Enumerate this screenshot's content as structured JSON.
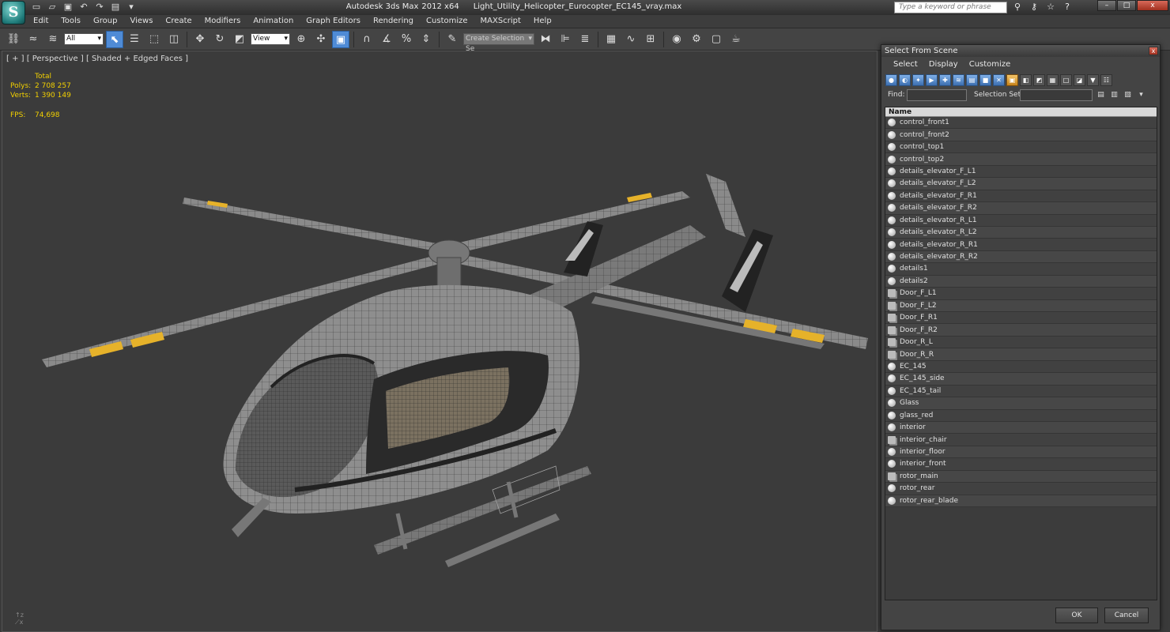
{
  "titlebar": {
    "app_name": "Autodesk 3ds Max",
    "version": "2012 x64",
    "filename": "Light_Utility_Helicopter_Eurocopter_EC145_vray.max",
    "search_placeholder": "Type a keyword or phrase",
    "logo_glyph": "S",
    "close_glyph": "x"
  },
  "menu": [
    "Edit",
    "Tools",
    "Group",
    "Views",
    "Create",
    "Modifiers",
    "Animation",
    "Graph Editors",
    "Rendering",
    "Customize",
    "MAXScript",
    "Help"
  ],
  "toolbar": {
    "filter_value": "All",
    "ref_coord_value": "View",
    "selection_set_value": "Create Selection Se"
  },
  "viewport": {
    "label": "[ + ] [ Perspective ] [ Shaded + Edged Faces ]",
    "stats": {
      "total_label": "Total",
      "polys_label": "Polys:",
      "polys_value": "2 708 257",
      "verts_label": "Verts:",
      "verts_value": "1 390 149",
      "fps_label": "FPS:",
      "fps_value": "74,698"
    }
  },
  "dialog": {
    "title": "Select From Scene",
    "menu": [
      "Select",
      "Display",
      "Customize"
    ],
    "find_label": "Find:",
    "selection_set_label": "Selection Set:",
    "column_name": "Name",
    "ok_label": "OK",
    "cancel_label": "Cancel",
    "items": [
      {
        "name": "control_front1",
        "kind": "object"
      },
      {
        "name": "control_front2",
        "kind": "object"
      },
      {
        "name": "control_top1",
        "kind": "object"
      },
      {
        "name": "control_top2",
        "kind": "object"
      },
      {
        "name": "details_elevator_F_L1",
        "kind": "object"
      },
      {
        "name": "details_elevator_F_L2",
        "kind": "object"
      },
      {
        "name": "details_elevator_F_R1",
        "kind": "object"
      },
      {
        "name": "details_elevator_F_R2",
        "kind": "object"
      },
      {
        "name": "details_elevator_R_L1",
        "kind": "object"
      },
      {
        "name": "details_elevator_R_L2",
        "kind": "object"
      },
      {
        "name": "details_elevator_R_R1",
        "kind": "object"
      },
      {
        "name": "details_elevator_R_R2",
        "kind": "object"
      },
      {
        "name": "details1",
        "kind": "object"
      },
      {
        "name": "details2",
        "kind": "object"
      },
      {
        "name": "Door_F_L1",
        "kind": "group"
      },
      {
        "name": "Door_F_L2",
        "kind": "group"
      },
      {
        "name": "Door_F_R1",
        "kind": "group"
      },
      {
        "name": "Door_F_R2",
        "kind": "group"
      },
      {
        "name": "Door_R_L",
        "kind": "group"
      },
      {
        "name": "Door_R_R",
        "kind": "group"
      },
      {
        "name": "EC_145",
        "kind": "object"
      },
      {
        "name": "EC_145_side",
        "kind": "object"
      },
      {
        "name": "EC_145_tail",
        "kind": "object"
      },
      {
        "name": "Glass",
        "kind": "object"
      },
      {
        "name": "glass_red",
        "kind": "object"
      },
      {
        "name": "interior",
        "kind": "object"
      },
      {
        "name": "interior_chair",
        "kind": "group"
      },
      {
        "name": "interior_floor",
        "kind": "object"
      },
      {
        "name": "interior_front",
        "kind": "object"
      },
      {
        "name": "rotor_main",
        "kind": "group"
      },
      {
        "name": "rotor_rear",
        "kind": "object"
      },
      {
        "name": "rotor_rear_blade",
        "kind": "object"
      }
    ]
  },
  "colors": {
    "stats_text": "#f2d000",
    "active_tool": "#4f8bd6",
    "viewport_bg": "#3b3b3b",
    "blade_stripe": "#e6b22a"
  }
}
